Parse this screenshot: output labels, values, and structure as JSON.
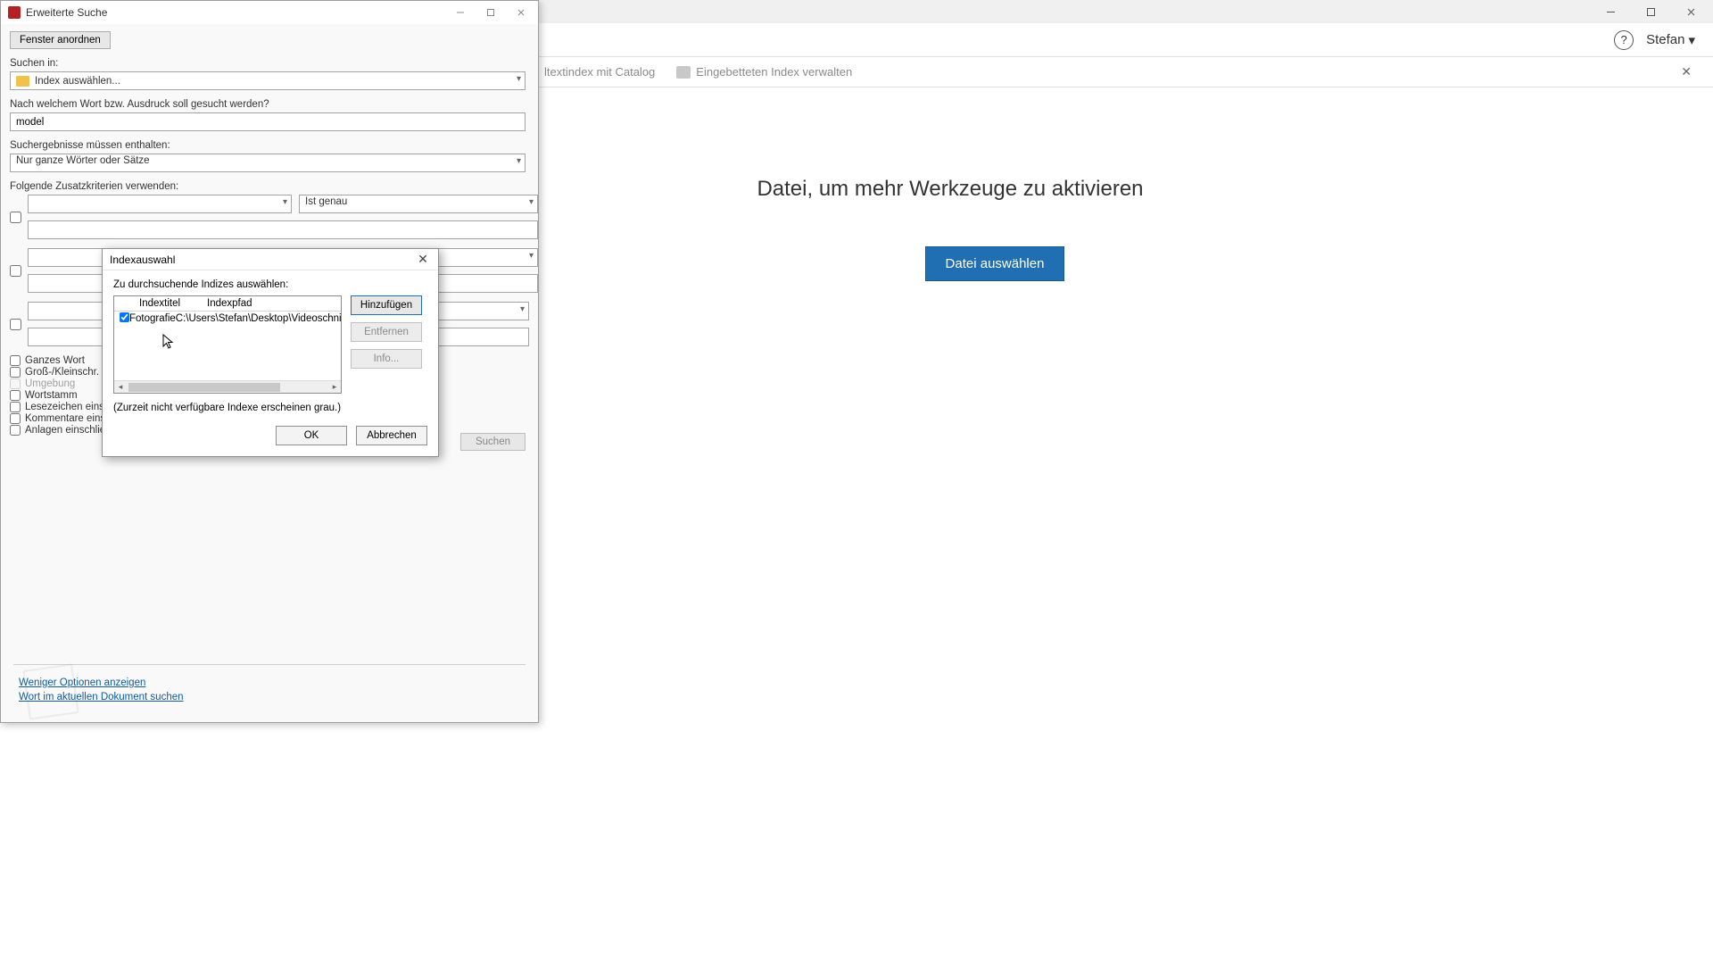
{
  "main": {
    "userName": "Stefan",
    "toolbar_catalog": "ltextindex mit Catalog",
    "toolbar_embedded": "Eingebetteten Index verwalten",
    "headline": "Datei, um mehr Werkzeuge zu aktivieren",
    "selectFileBtn": "Datei auswählen"
  },
  "search": {
    "title": "Erweiterte Suche",
    "arrangeWindows": "Fenster anordnen",
    "searchIn_label": "Suchen in:",
    "searchIn_value": "Index auswählen...",
    "query_label": "Nach welchem Wort bzw. Ausdruck soll gesucht werden?",
    "query_value": "model",
    "results_label": "Suchergebnisse müssen enthalten:",
    "results_value": "Nur ganze Wörter oder Sätze",
    "criteria_label": "Folgende Zusatzkriterien verwenden:",
    "criteria_operator": "Ist genau",
    "options": {
      "wholeWord": "Ganzes Wort",
      "caseSensitive": "Groß-/Kleinschr.",
      "proximity": "Umgebung",
      "stem": "Wortstamm",
      "bookmarks": "Lesezeichen einschließen",
      "comments": "Kommentare einschließen",
      "attachments": "Anlagen einschließen"
    },
    "searchBtn": "Suchen",
    "lessOptions": "Weniger Optionen anzeigen",
    "docSearch": "Wort im aktuellen Dokument suchen"
  },
  "dlg": {
    "title": "Indexauswahl",
    "prompt": "Zu durchsuchende Indizes auswählen:",
    "col_title": "Indextitel",
    "col_path": "Indexpfad",
    "row1_title": "Fotografie",
    "row1_path": "C:\\Users\\Stefan\\Desktop\\Videoschnit",
    "add": "Hinzufügen",
    "remove": "Entfernen",
    "info": "Info...",
    "note": "(Zurzeit nicht verfügbare Indexe erscheinen grau.)",
    "ok": "OK",
    "cancel": "Abbrechen"
  }
}
